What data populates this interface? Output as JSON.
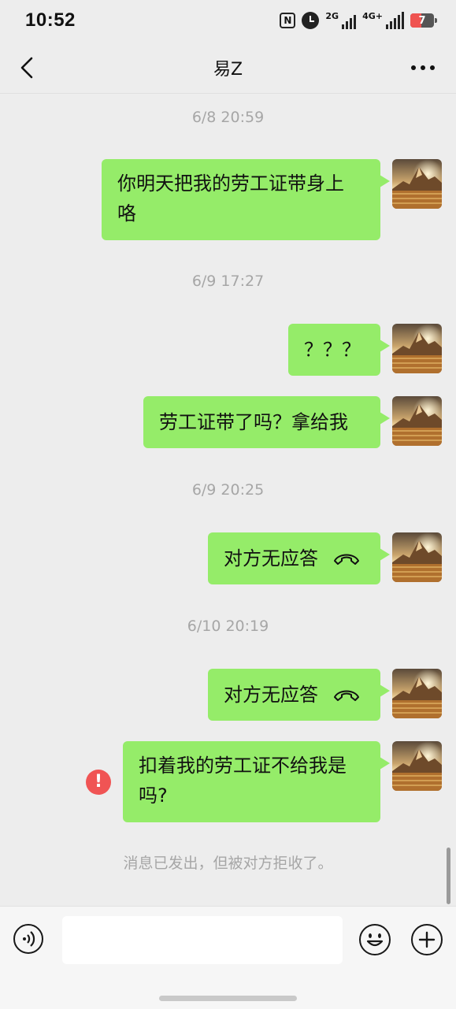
{
  "status_bar": {
    "time": "10:52",
    "nfc_label": "N",
    "net1_label": "2G",
    "net2_label": "4G+",
    "battery_level": "7",
    "battery_color": "#ef5350"
  },
  "header": {
    "title": "易Z",
    "back_icon": "chevron-left-icon",
    "more_icon": "more-dots-icon"
  },
  "messages": [
    {
      "timestamp": "6/8 20:59"
    },
    {
      "text_line1": "你明天把我的劳工证带身上",
      "text_line2": "咯"
    },
    {
      "timestamp": "6/9 17:27"
    },
    {
      "text": "？？？"
    },
    {
      "text": "劳工证带了吗？拿给我"
    },
    {
      "timestamp": "6/9 20:25"
    },
    {
      "text": "对方无应答",
      "icon": "phone-hangup-icon"
    },
    {
      "timestamp": "6/10 20:19"
    },
    {
      "text": "对方无应答",
      "icon": "phone-hangup-icon"
    },
    {
      "text_line1": "扣着我的劳工证不给我是",
      "text_line2": "吗?",
      "status": "failed",
      "status_symbol": "!"
    }
  ],
  "system_notice": "消息已发出，但被对方拒收了。",
  "input_bar": {
    "voice_icon": "voice-icon",
    "text_value": "",
    "emoji_icon": "emoji-icon",
    "plus_icon": "plus-icon"
  },
  "colors": {
    "bubble_green": "#95ec69",
    "background": "#ededed",
    "error_red": "#f05454"
  }
}
